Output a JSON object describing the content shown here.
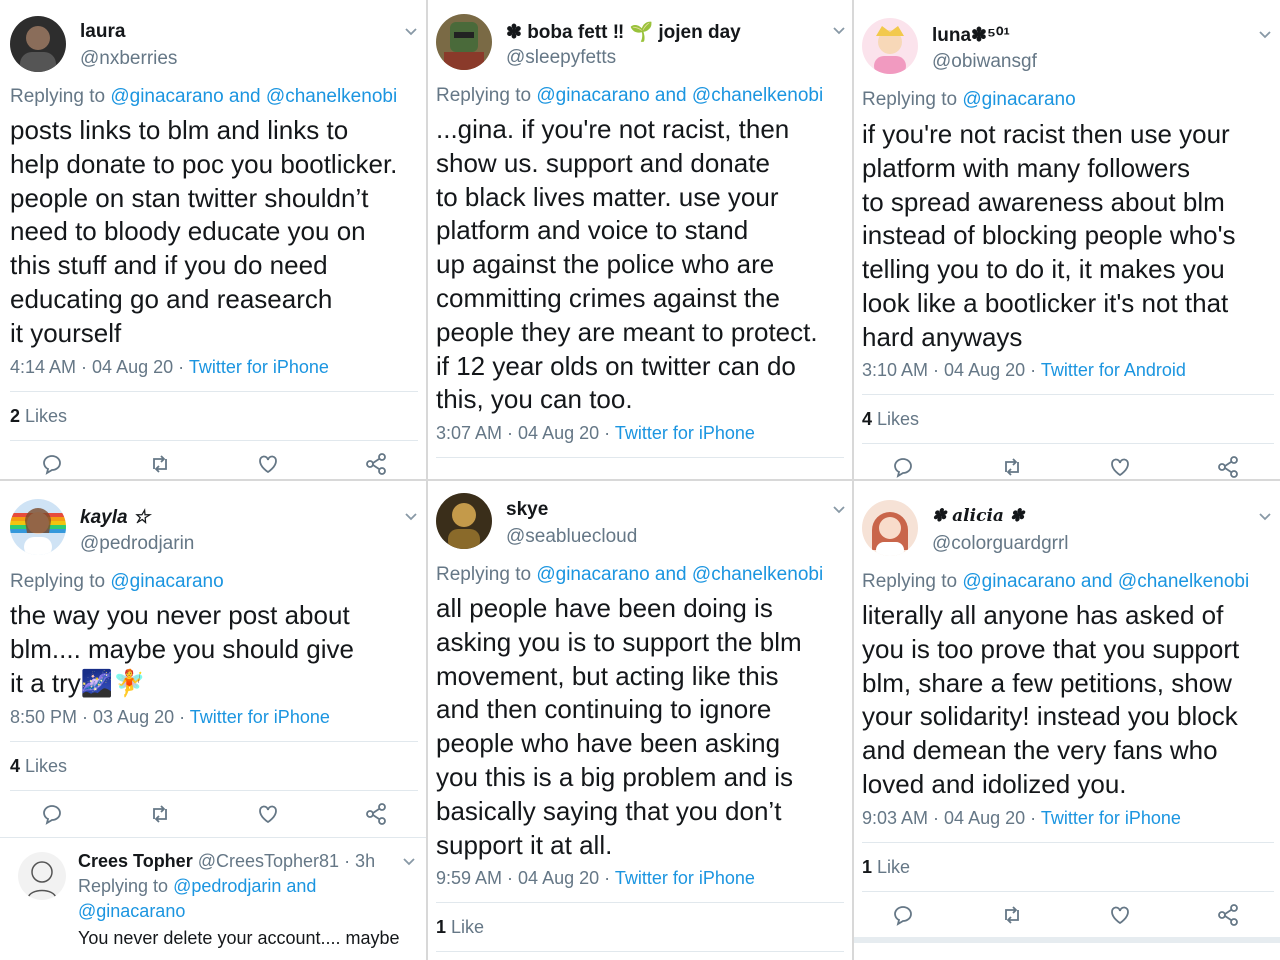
{
  "tweets": [
    {
      "display_name": "laura",
      "handle": "@nxberries",
      "reply_prefix": "Replying to",
      "reply_to": "@ginacarano and @chanelkenobi",
      "text": "posts links to blm and links to\nhelp donate to poc you bootlicker.\npeople on stan twitter shouldn’t\nneed to bloody educate you on\nthis stuff and if you do need\neducating go and reasearch\nit yourself",
      "time": "4:14 AM · 04 Aug 20 ·",
      "source": "Twitter for iPhone",
      "likes_count": "2",
      "likes_label": "Likes",
      "avatar_color": "#3a3a3a"
    },
    {
      "display_name": "✽ boba fett ‼ 🌱 jojen day",
      "handle": "@sleepyfetts",
      "reply_prefix": "Replying to",
      "reply_to": "@ginacarano and @chanelkenobi",
      "text": "...gina. if you're not racist, then\nshow us. support and donate\nto black lives matter. use your\nplatform and voice to stand\nup against the police who are\ncommitting crimes against the\npeople they are meant to protect.\nif 12 year olds on twitter can do\nthis, you can too.",
      "time": "3:07 AM · 04 Aug 20 ·",
      "source": "Twitter for iPhone",
      "likes_count": "",
      "likes_label": "",
      "avatar_color": "#6b5a3a"
    },
    {
      "display_name": "luna✽⁵⁰¹",
      "handle": "@obiwansgf",
      "reply_prefix": "Replying to",
      "reply_to": "@ginacarano",
      "text": "if you're not racist then use your\nplatform with many followers\nto spread awareness about blm\ninstead of blocking people who's\ntelling you to do it, it makes you\nlook like a bootlicker it's not that\nhard anyways",
      "time": "3:10 AM · 04 Aug 20 ·",
      "source": "Twitter for Android",
      "likes_count": "4",
      "likes_label": "Likes",
      "avatar_color": "#f4c6d8"
    },
    {
      "display_name": "kayla ☆",
      "handle": "@pedrodjarin",
      "reply_prefix": "Replying to",
      "reply_to": "@ginacarano",
      "text": "the way you never post about\nblm.... maybe you should give\nit a try🌌🧚",
      "time": "8:50 PM · 03 Aug 20 ·",
      "source": "Twitter for iPhone",
      "likes_count": "4",
      "likes_label": "Likes",
      "avatar_color": "#e9b8a0"
    },
    {
      "display_name": "skye",
      "handle": "@seabluecloud",
      "reply_prefix": "Replying to",
      "reply_to": "@ginacarano and @chanelkenobi",
      "text": "all people have been doing is\nasking you is to support the blm\nmovement, but acting like this\nand then continuing to ignore\npeople who have been asking\nyou this is a big problem and is\nbasically saying that you don’t\nsupport it at all.",
      "time": "9:59 AM · 04 Aug 20 ·",
      "source": "Twitter for iPhone",
      "likes_count": "1",
      "likes_label": "Like",
      "avatar_color": "#4a3a1e"
    },
    {
      "display_name": "✽ alicia ✽",
      "handle": "@colorguardgrrl",
      "reply_prefix": "Replying to",
      "reply_to": "@ginacarano and @chanelkenobi",
      "text": "literally all anyone has asked of\nyou is too prove that you support\nblm, share a few petitions, show\nyour solidarity! instead you block\nand demean the very fans who\nloved and idolized you.",
      "time": "9:03 AM · 04 Aug 20 ·",
      "source": "Twitter for iPhone",
      "likes_count": "1",
      "likes_label": "Like",
      "avatar_color": "#d98a6e"
    }
  ],
  "comment": {
    "name": "Crees Topher",
    "handle": "@CreesTopher81 · 3h",
    "reply_prefix": "Replying to",
    "reply_to_1": "@pedrodjarin and",
    "reply_to_2": "@ginacarano",
    "text": "You never delete your account.... maybe"
  },
  "icons": {
    "reply": "reply-icon",
    "retweet": "retweet-icon",
    "like": "heart-icon",
    "share": "share-icon",
    "menu": "chevron-down-icon"
  },
  "colors": {
    "link": "#1b95e0",
    "muted": "#657786",
    "text": "#14171a",
    "divider": "#e1e8ed"
  }
}
